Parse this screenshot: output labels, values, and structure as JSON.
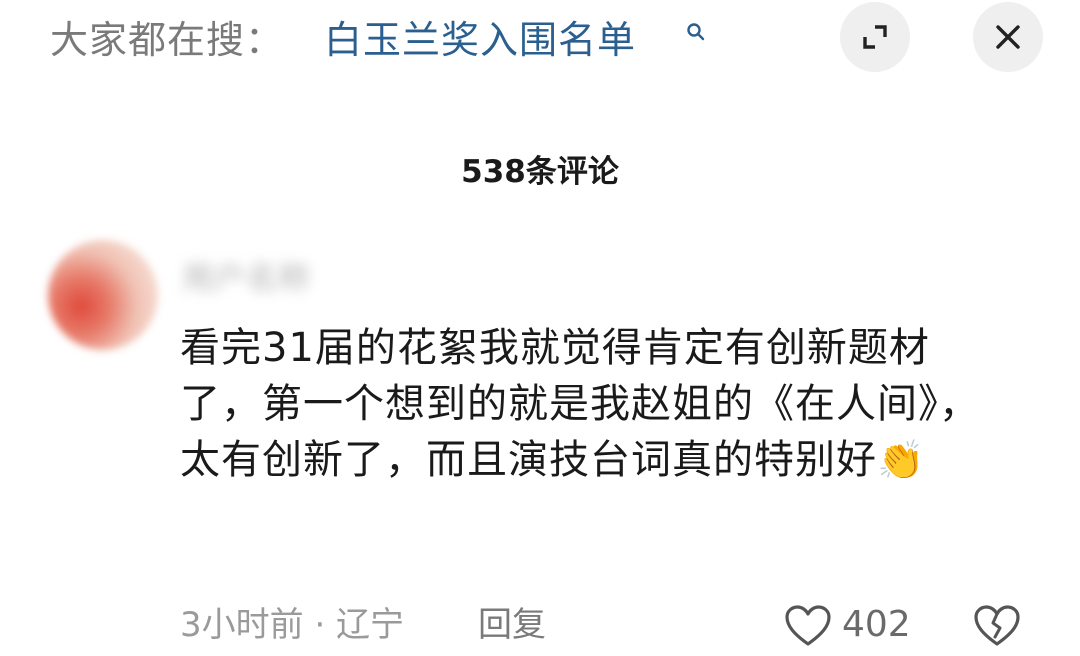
{
  "search_bar": {
    "prefix": "大家都在搜：",
    "query": "白玉兰奖入围名单",
    "search_icon": "search-icon"
  },
  "top_actions": {
    "expand_icon": "expand-icon",
    "close_icon": "close-icon"
  },
  "comments_header": {
    "count_label": "538条评论"
  },
  "comment": {
    "username": "用户名称",
    "text": "看完31届的花絮我就觉得肯定有创新题材了，第一个想到的就是我赵姐的《在人间》，太有创新了，而且演技台词真的特别好",
    "emoji": "👏",
    "meta": "3小时前 · 辽宁",
    "reply_label": "回复",
    "like_count": "402",
    "like_icon": "heart-outline-icon",
    "dislike_icon": "broken-heart-icon"
  },
  "colors": {
    "accent_link": "#2a5f8f",
    "muted_text": "#9a9a9a",
    "button_bg": "#efefef"
  }
}
